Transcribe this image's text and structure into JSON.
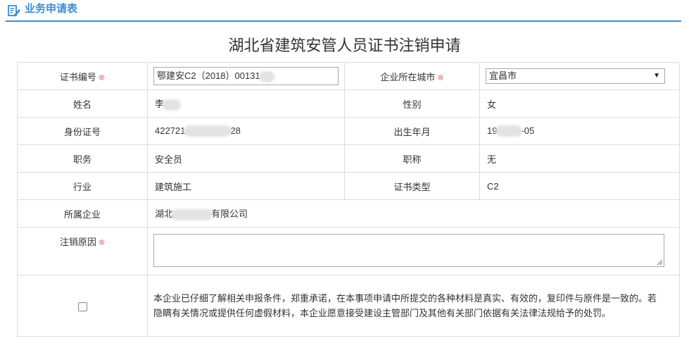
{
  "header": {
    "title": "业务申请表"
  },
  "form": {
    "title": "湖北省建筑安管人员证书注销申请",
    "required_mark": "❊",
    "rows": {
      "cert_no": {
        "label": "证书编号",
        "value": "鄂建安C2（2018）00131"
      },
      "city": {
        "label": "企业所在城市",
        "value": "宜昌市"
      },
      "name": {
        "label": "姓名",
        "value": "李"
      },
      "gender": {
        "label": "性别",
        "value": "女"
      },
      "id_no": {
        "label": "身份证号",
        "value_prefix": "422721",
        "value_suffix": "28"
      },
      "birth": {
        "label": "出生年月",
        "value_prefix": "19",
        "value_suffix": "-05"
      },
      "position": {
        "label": "职务",
        "value": "安全员"
      },
      "title": {
        "label": "职称",
        "value": "无"
      },
      "industry": {
        "label": "行业",
        "value": "建筑施工"
      },
      "cert_type": {
        "label": "证书类型",
        "value": "C2"
      },
      "company": {
        "label": "所属企业",
        "value_prefix": "湖北",
        "value_suffix": "有限公司"
      },
      "reason": {
        "label": "注销原因",
        "value": ""
      }
    },
    "declaration": {
      "checked": false,
      "text": "本企业已仔细了解相关申报条件，郑重承诺，在本事项申请中所提交的各种材料是真实、有效的，复印件与原件是一致的。若隐瞒有关情况或提供任何虚假材料，本企业愿意接受建设主管部门及其他有关部门依据有关法律法规给予的处罚。"
    }
  },
  "colors": {
    "accent": "#3c8dd4",
    "required": "#d9534f",
    "declaration": "#a94442",
    "border": "#dddddd"
  },
  "icons": {
    "header": "edit-form-icon",
    "select": "triangle-down-icon"
  }
}
